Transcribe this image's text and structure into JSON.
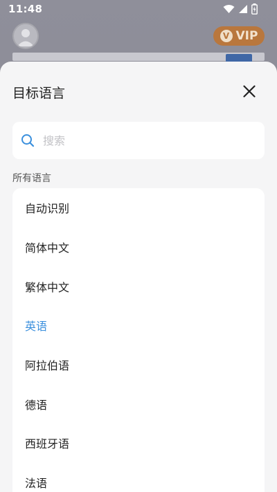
{
  "status_bar": {
    "time": "11:48"
  },
  "background": {
    "vip_label": "VIP",
    "vip_badge_glyph": "V"
  },
  "sheet": {
    "title": "目标语言",
    "search_placeholder": "搜索",
    "section_label": "所有语言",
    "selected_language": "英语",
    "languages": [
      {
        "label": "自动识别"
      },
      {
        "label": "简体中文"
      },
      {
        "label": "繁体中文"
      },
      {
        "label": "英语"
      },
      {
        "label": "阿拉伯语"
      },
      {
        "label": "德语"
      },
      {
        "label": "西班牙语"
      },
      {
        "label": "法语"
      }
    ]
  },
  "colors": {
    "accent": "#3a8fdd",
    "sheet_bg": "#f5f5f6",
    "text": "#222222",
    "vip": "#b9773d"
  }
}
